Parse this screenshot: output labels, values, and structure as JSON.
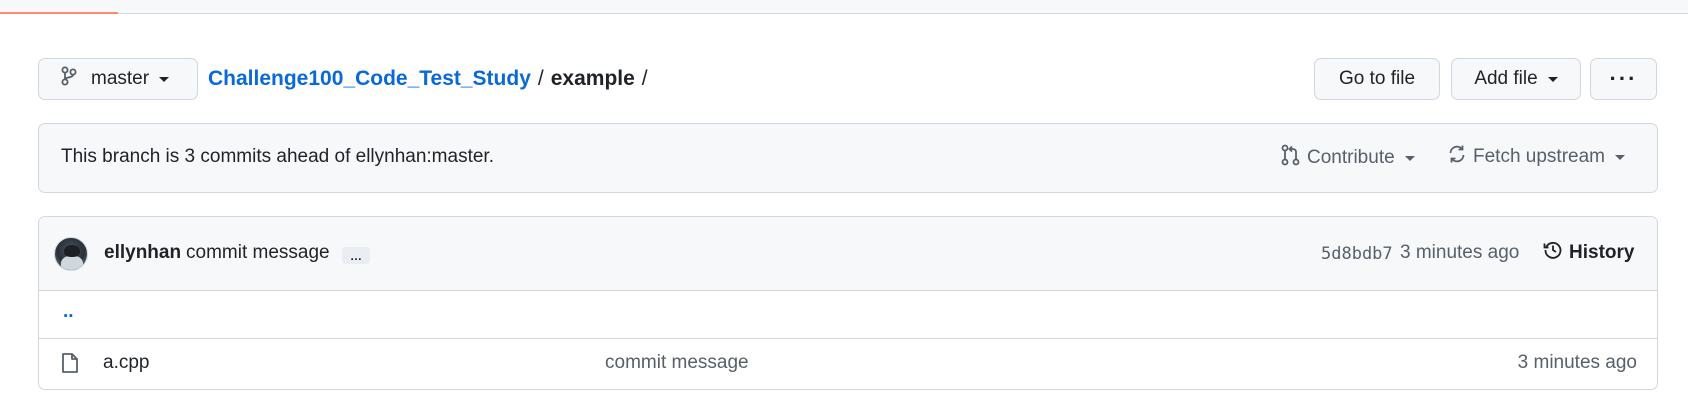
{
  "loading_bar": {
    "progress_fraction": 0.07,
    "color": "#fd8c73"
  },
  "branch": {
    "name": "master",
    "icon": "git-branch-icon"
  },
  "breadcrumb": {
    "repo": "Challenge100_Code_Test_Study",
    "sep": "/",
    "dir": "example",
    "trailing_sep": "/"
  },
  "toolbar": {
    "goto_label": "Go to file",
    "addfile_label": "Add file",
    "more_label": "···"
  },
  "banner": {
    "message": "This branch is 3 commits ahead of ellynhan:master.",
    "contribute_label": "Contribute",
    "fetch_label": "Fetch upstream"
  },
  "latest_commit": {
    "author": "ellynhan",
    "message": "commit message",
    "ellipsis": "…",
    "sha": "5d8bdb7",
    "time": "3 minutes ago",
    "history_label": "History"
  },
  "parent_dir": "..",
  "files": [
    {
      "name": "a.cpp",
      "commit_message": "commit message",
      "time": "3 minutes ago",
      "icon": "file-icon"
    }
  ],
  "colors": {
    "link": "#0969da",
    "border": "#d0d7de",
    "muted": "#57606a",
    "accent_bar": "#fd8c73"
  }
}
